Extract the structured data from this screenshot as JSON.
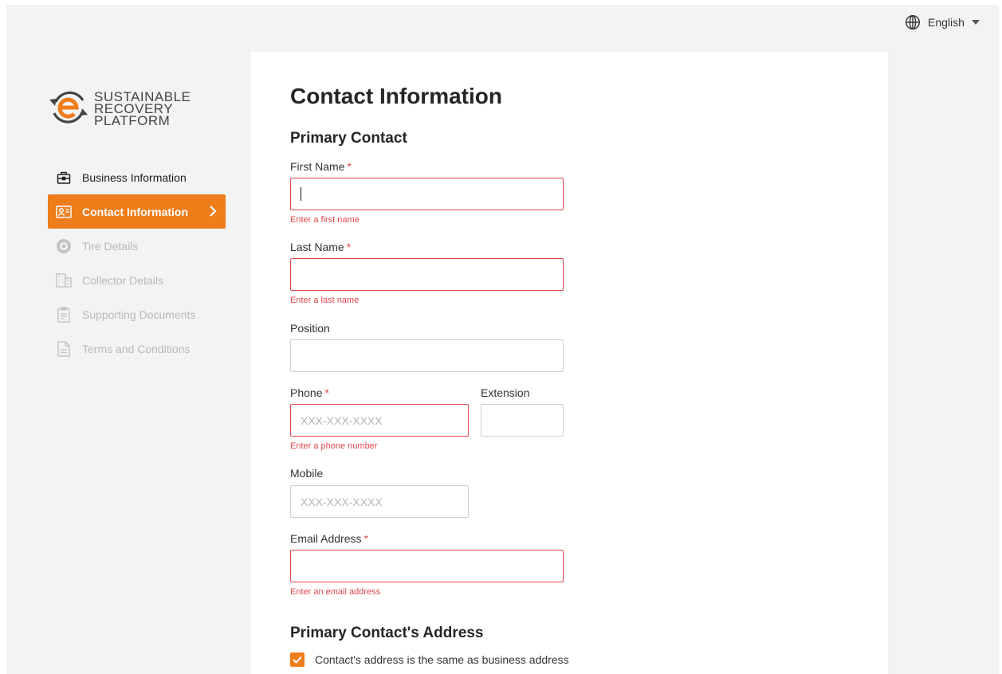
{
  "language": {
    "label": "English",
    "icon": "globe-icon"
  },
  "logo": {
    "lines": [
      "SUSTAINABLE",
      "RECOVERY",
      "PLATFORM"
    ]
  },
  "nav": {
    "items": [
      {
        "label": "Business Information",
        "icon": "briefcase-icon",
        "state": "done"
      },
      {
        "label": "Contact Information",
        "icon": "contact-card-icon",
        "state": "active"
      },
      {
        "label": "Tire Details",
        "icon": "tire-icon",
        "state": "disabled"
      },
      {
        "label": "Collector Details",
        "icon": "building-icon",
        "state": "disabled"
      },
      {
        "label": "Supporting Documents",
        "icon": "clipboard-icon",
        "state": "disabled"
      },
      {
        "label": "Terms and Conditions",
        "icon": "document-icon",
        "state": "disabled"
      }
    ]
  },
  "form": {
    "title": "Contact Information",
    "section_primary": "Primary Contact",
    "required_mark": "*",
    "first_name": {
      "label": "First Name",
      "value": "",
      "error": "Enter a first name"
    },
    "last_name": {
      "label": "Last Name",
      "value": "",
      "error": "Enter a last name"
    },
    "position": {
      "label": "Position",
      "value": ""
    },
    "phone": {
      "label": "Phone",
      "placeholder": "XXX-XXX-XXXX",
      "error": "Enter a phone number"
    },
    "extension": {
      "label": "Extension",
      "value": ""
    },
    "mobile": {
      "label": "Mobile",
      "placeholder": "XXX-XXX-XXXX"
    },
    "email": {
      "label": "Email Address",
      "value": "",
      "error": "Enter an email address"
    },
    "section_address": "Primary Contact's Address",
    "same_address": {
      "label": "Contact's address is the same as business address",
      "checked": true
    }
  },
  "colors": {
    "accent": "#ef7d1a",
    "error": "#e0484b",
    "background": "#f3f3f3"
  }
}
